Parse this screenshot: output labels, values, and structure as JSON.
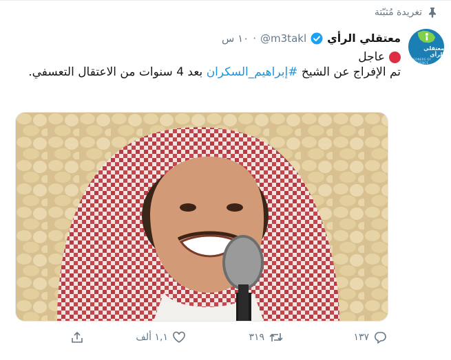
{
  "pinned": {
    "label": "تغريدة مُثبّتة",
    "icon": "pin-icon"
  },
  "author": {
    "display_name": "معتقلي الرأي",
    "handle": "@m3takl",
    "separator": "·",
    "time": "١٠ س",
    "avatar_text": "معتقلي الرأي",
    "avatar_subtext": "PRISONERS OF CONSCIENCE"
  },
  "tweet": {
    "line1_text": "عاجل",
    "text_before": "تم الإفراج عن الشيخ ",
    "hashtag": "#إبراهيم_السكران",
    "text_after": " بعد 4 سنوات من الاعتقال التعسفي."
  },
  "actions": {
    "reply_count": "١٣٧",
    "retweet_count": "٣١٩",
    "like_count": "١,١ ألف"
  },
  "colors": {
    "accent": "#1b95e0",
    "muted": "#657786",
    "alert": "#dd2e44"
  }
}
